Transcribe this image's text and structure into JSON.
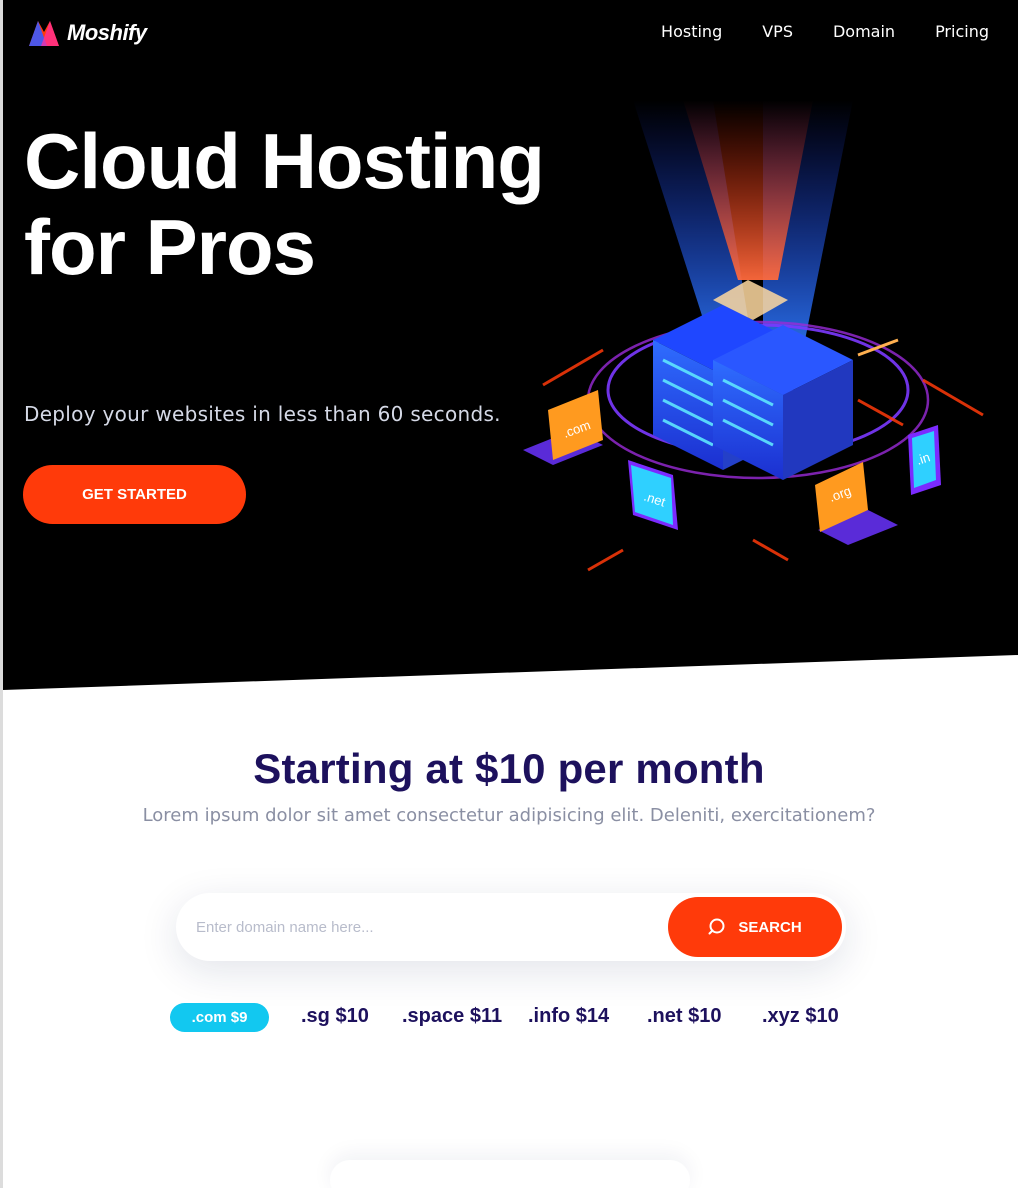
{
  "brand": {
    "name": "Moshify",
    "colors": {
      "red": "#ff3a0a",
      "blue": "#2d6bff"
    }
  },
  "nav": {
    "items": [
      "Hosting",
      "VPS",
      "Domain",
      "Pricing"
    ]
  },
  "hero": {
    "title": "Cloud Hosting for Pros",
    "subtitle": "Deploy your websites in less than 60 seconds.",
    "cta_label": "GET STARTED",
    "illustration_labels": {
      "com": ".com",
      "net": ".net",
      "org": ".org",
      "in": ".in"
    }
  },
  "pricing": {
    "heading": "Starting at $10 per month",
    "description": "Lorem ipsum dolor sit amet consectetur adipisicing elit. Deleniti, exercitationem?"
  },
  "search": {
    "placeholder": "Enter domain name here...",
    "button_label": "SEARCH",
    "icon": "search-icon"
  },
  "tlds": [
    {
      "label": ".com $9",
      "active": true
    },
    {
      "label": ".sg $10",
      "active": false
    },
    {
      "label": ".space $11",
      "active": false
    },
    {
      "label": ".info $14",
      "active": false
    },
    {
      "label": ".net $10",
      "active": false
    },
    {
      "label": ".xyz $10",
      "active": false
    }
  ],
  "theme": {
    "accent": "#ff3a0a",
    "heading": "#1d115d",
    "cyan": "#12c8f0",
    "hero_bg": "#000000"
  }
}
